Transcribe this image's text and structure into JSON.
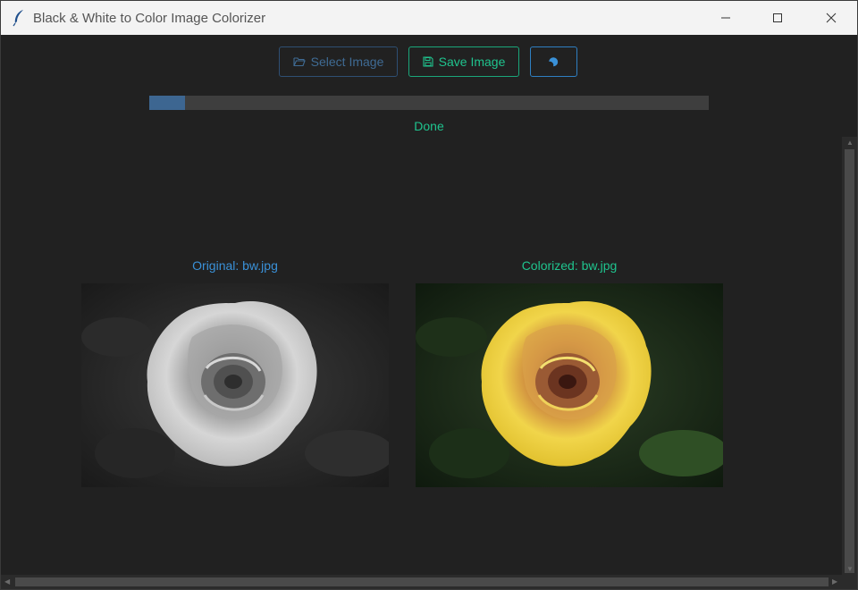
{
  "window": {
    "title": "Black & White to Color Image Colorizer"
  },
  "toolbar": {
    "select_label": "Select Image",
    "save_label": "Save Image",
    "theme_icon": "moon-icon"
  },
  "progress": {
    "fraction": 0.064
  },
  "status": {
    "text": "Done"
  },
  "panels": {
    "original_label": "Original: bw.jpg",
    "colorized_label": "Colorized: bw.jpg"
  },
  "colors": {
    "accent_blue": "#3a91d8",
    "accent_green": "#1fc48e",
    "background": "#212121"
  }
}
